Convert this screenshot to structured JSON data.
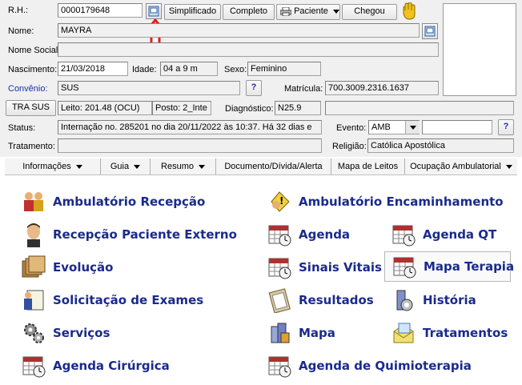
{
  "header": {
    "rh_label": "R.H.:",
    "rh_value": "0000179648",
    "btn_simplificado": "Simplificado",
    "btn_completo": "Completo",
    "btn_paciente": "Paciente",
    "btn_chegou": "Chegou",
    "nome_label": "Nome:",
    "nome_value": "MAYRA",
    "nome_social_label": "Nome Social:",
    "nome_social_value": "",
    "nascimento_label": "Nascimento:",
    "nascimento_value": "21/03/2018",
    "idade_label": "Idade:",
    "idade_value": "04 a 9 m",
    "sexo_label": "Sexo:",
    "sexo_value": "Feminino",
    "convenio_label": "Convênio:",
    "convenio_value": "SUS",
    "help_q": "?",
    "matricula_label": "Matrícula:",
    "matricula_value": "700.3009.2316.1637",
    "btn_tra_sus": "TRA SUS",
    "leito_value": "Leito: 201.48 (OCU)",
    "posto_value": "Posto: 2_Inte",
    "diagnostico_label": "Diagnóstico:",
    "diagnostico_value": "N25.9",
    "status_label": "Status:",
    "status_value": "Internação no. 285201 no dia 20/11/2022  às  10:37. Há 32 dias e",
    "evento_label": "Evento:",
    "evento_value": "AMB",
    "tratamento_label": "Tratamento:",
    "tratamento_value": "",
    "religiao_label": "Religião:",
    "religiao_value": "Católica Apostólica"
  },
  "tabs": [
    {
      "label": "Informações",
      "dropdown": true
    },
    {
      "label": "Guia",
      "dropdown": true
    },
    {
      "label": "Resumo",
      "dropdown": true
    },
    {
      "label": "Documento/Dívida/Alerta",
      "dropdown": false
    },
    {
      "label": "Mapa de Leitos",
      "dropdown": false
    },
    {
      "label": "Ocupação Ambulatorial",
      "dropdown": true
    }
  ],
  "menu": {
    "left": [
      {
        "label": "Ambulatório Recepção",
        "icon": "people-group-icon"
      },
      {
        "label": "Recepção Paciente Externo",
        "icon": "person-face-icon"
      },
      {
        "label": "Evolução",
        "icon": "folders-icon"
      },
      {
        "label": "Solicitação de Exames",
        "icon": "lab-request-icon"
      },
      {
        "label": "Serviços",
        "icon": "gears-icon"
      },
      {
        "label": "Agenda Cirúrgica",
        "icon": "calendar-clock-icon"
      }
    ],
    "right": [
      {
        "label": "Ambulatório Encaminhamento",
        "icon": "referral-icon"
      },
      {
        "label": "Agenda",
        "icon": "calendar-clock-icon"
      },
      {
        "label": "Sinais Vitais",
        "icon": "calendar-clock-icon"
      },
      {
        "label": "Resultados",
        "icon": "clipboard-icon"
      },
      {
        "label": "Mapa",
        "icon": "building-icon"
      },
      {
        "label": "Agenda de Quimioterapia",
        "icon": "calendar-clock-icon"
      }
    ],
    "far_right": [
      {
        "label": "Agenda QT",
        "icon": "calendar-clock-icon"
      },
      {
        "label": "Mapa Terapia",
        "icon": "calendar-clock-icon"
      },
      {
        "label": "História",
        "icon": "history-icon"
      },
      {
        "label": "Tratamentos",
        "icon": "envelope-icon"
      }
    ]
  },
  "colors": {
    "link_blue": "#1a2a8c",
    "annotation_red": "#e02020"
  }
}
